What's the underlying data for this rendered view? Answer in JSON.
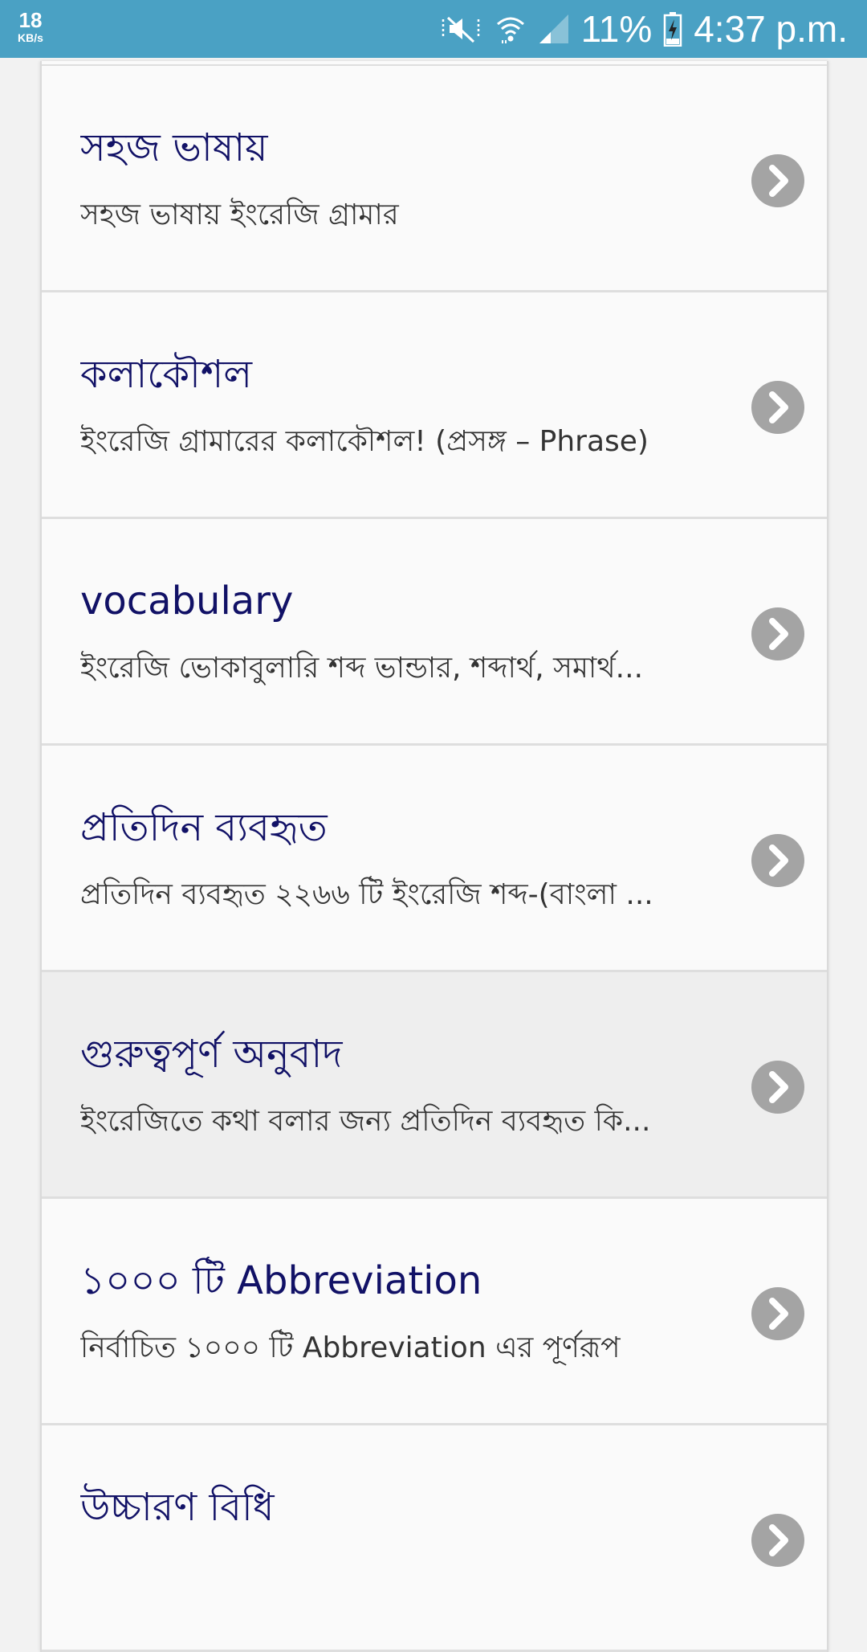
{
  "status_bar": {
    "net_speed_value": "18",
    "net_speed_unit": "KB/s",
    "battery_percent": "11%",
    "time": "4:37 p.m.",
    "icons": [
      "mute-icon",
      "wifi-icon",
      "cell-signal-icon",
      "battery-charging-icon"
    ]
  },
  "items": [
    {
      "title": "সহজ ভাষায়",
      "subtitle": "সহজ ভাষায় ইংরেজি গ্রামার"
    },
    {
      "title": "কলাকৌশল",
      "subtitle": "ইংরেজি গ্রামারের কলাকৌশল! (প্রসঙ্গ – Phrase)"
    },
    {
      "title": "vocabulary",
      "subtitle": "ইংরেজি ভোকাবুলারি শব্দ ভান্ডার, শব্দার্থ, সমার্থ..."
    },
    {
      "title": "প্রতিদিন ব্যবহৃত",
      "subtitle": "প্রতিদিন ব্যবহৃত ২২৬৬ টি ইংরেজি শব্দ-(বাংলা ..."
    },
    {
      "title": "গুরুত্বপূর্ণ অনুবাদ",
      "subtitle": "ইংরেজিতে কথা বলার জন্য প্রতিদিন ব্যবহৃত কি..."
    },
    {
      "title": "১০০০ টি Abbreviation",
      "subtitle": "নির্বাচিত ১০০০ টি Abbreviation এর পূর্ণরূপ"
    },
    {
      "title": "উচ্চারণ বিধি",
      "subtitle": ""
    }
  ],
  "colors": {
    "status_bar": "#4aa1c4",
    "title_text": "#111166",
    "chevron_bg": "#a4a4a4",
    "pressed_row": "#eeeeee"
  }
}
